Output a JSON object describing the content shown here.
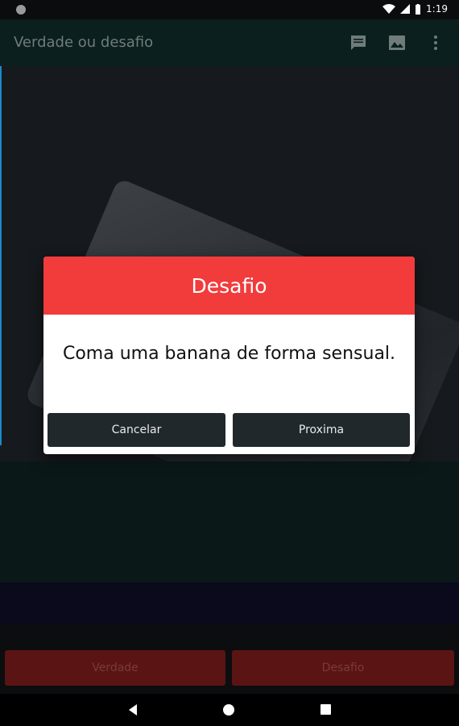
{
  "status_bar": {
    "time": "1:19"
  },
  "app_bar": {
    "title": "Verdade ou desafio",
    "actions": [
      "chat-icon",
      "image-icon",
      "more-vert-icon"
    ]
  },
  "dialog": {
    "title": "Desafio",
    "message": "Coma uma banana de forma sensual.",
    "cancel_label": "Cancelar",
    "next_label": "Proxima",
    "header_color": "#f23b3b",
    "button_color": "#21282c"
  },
  "bottom_buttons": {
    "truth_label": "Verdade",
    "dare_label": "Desafio",
    "color": "#5a1414"
  },
  "nav_bar": {
    "icons": [
      "back-icon",
      "home-icon",
      "recents-icon"
    ]
  }
}
